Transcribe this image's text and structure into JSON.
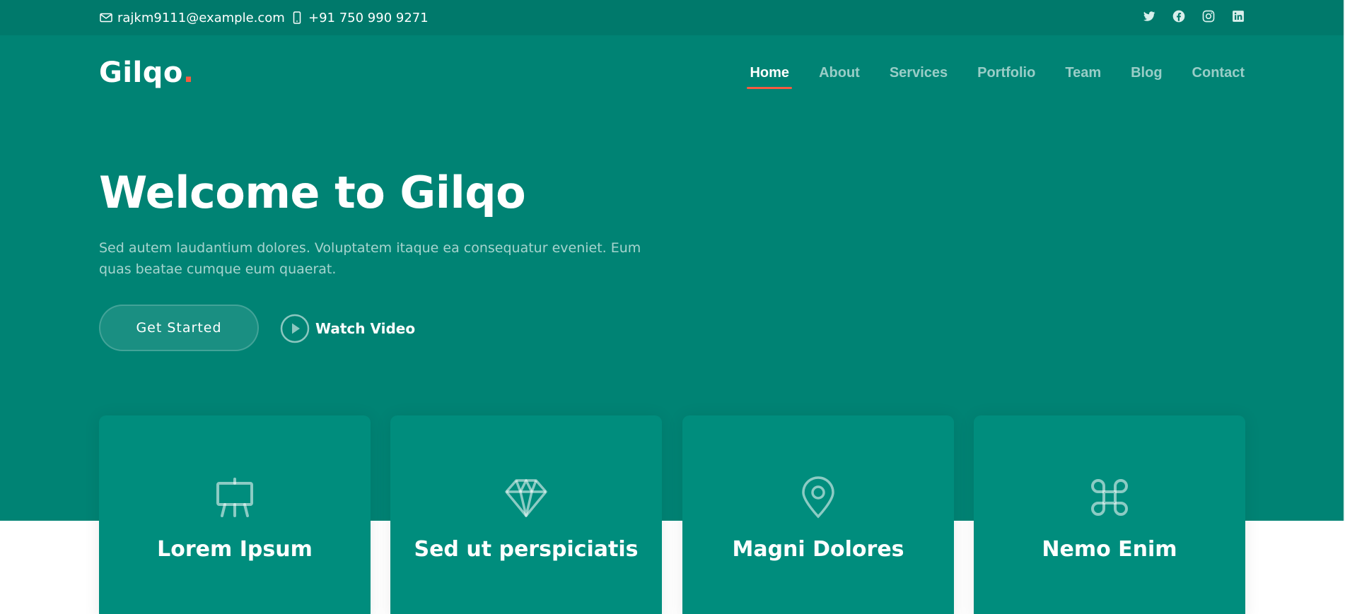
{
  "topbar": {
    "email": "rajkm9111@example.com",
    "phone": "+91 750 990 9271",
    "social": [
      "twitter-icon",
      "facebook-icon",
      "instagram-icon",
      "linkedin-icon"
    ]
  },
  "header": {
    "logo": "Gilqo",
    "logo_dot": ".",
    "nav": [
      {
        "label": "Home",
        "active": true
      },
      {
        "label": "About"
      },
      {
        "label": "Services"
      },
      {
        "label": "Portfolio"
      },
      {
        "label": "Team"
      },
      {
        "label": "Blog"
      },
      {
        "label": "Contact"
      }
    ]
  },
  "hero": {
    "title": "Welcome to Gilqo",
    "description": "Sed autem laudantium dolores. Voluptatem itaque ea consequatur eveniet. Eum quas beatae cumque eum quaerat.",
    "cta_label": "Get Started",
    "video_label": "Watch Video"
  },
  "cards": [
    {
      "title": "Lorem Ipsum",
      "icon": "easel-icon"
    },
    {
      "title": "Sed ut perspiciatis",
      "icon": "gem-icon"
    },
    {
      "title": "Magni Dolores",
      "icon": "geo-pin-icon"
    },
    {
      "title": "Nemo Enim",
      "icon": "command-icon"
    }
  ],
  "colors": {
    "primary": "#008374",
    "topbar": "#00796b",
    "card": "#008d7d",
    "accent": "#f85a40"
  }
}
